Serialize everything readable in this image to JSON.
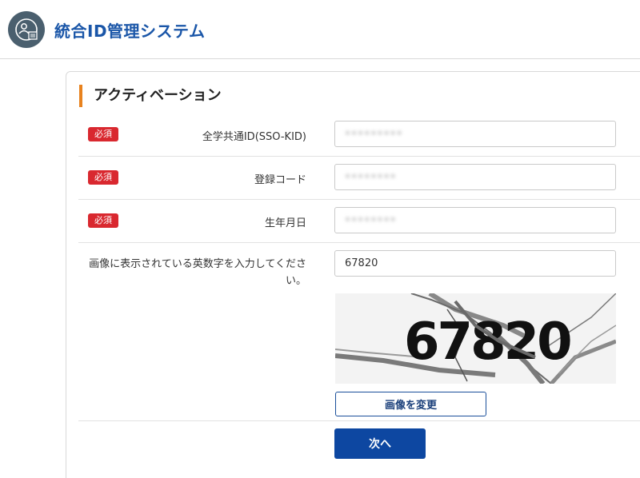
{
  "header": {
    "title": "統合ID管理システム",
    "logo_icon": "user-shield-icon"
  },
  "section": {
    "title": "アクティベーション"
  },
  "required_badge": "必須",
  "fields": [
    {
      "label": "全学共通ID(SSO-KID)",
      "value": "•••••••••",
      "required": true
    },
    {
      "label": "登録コード",
      "value": "••••••••",
      "required": true
    },
    {
      "label": "生年月日",
      "value": "••••••••",
      "required": true
    }
  ],
  "captcha": {
    "label": "画像に表示されている英数字を入力してください。",
    "value": "67820",
    "image_text": "67820",
    "change_button": "画像を変更"
  },
  "next_button": "次へ",
  "colors": {
    "brand": "#1a56a8",
    "accent": "#e8821e",
    "required": "#d9282f",
    "primary_button": "#0d47a1"
  }
}
